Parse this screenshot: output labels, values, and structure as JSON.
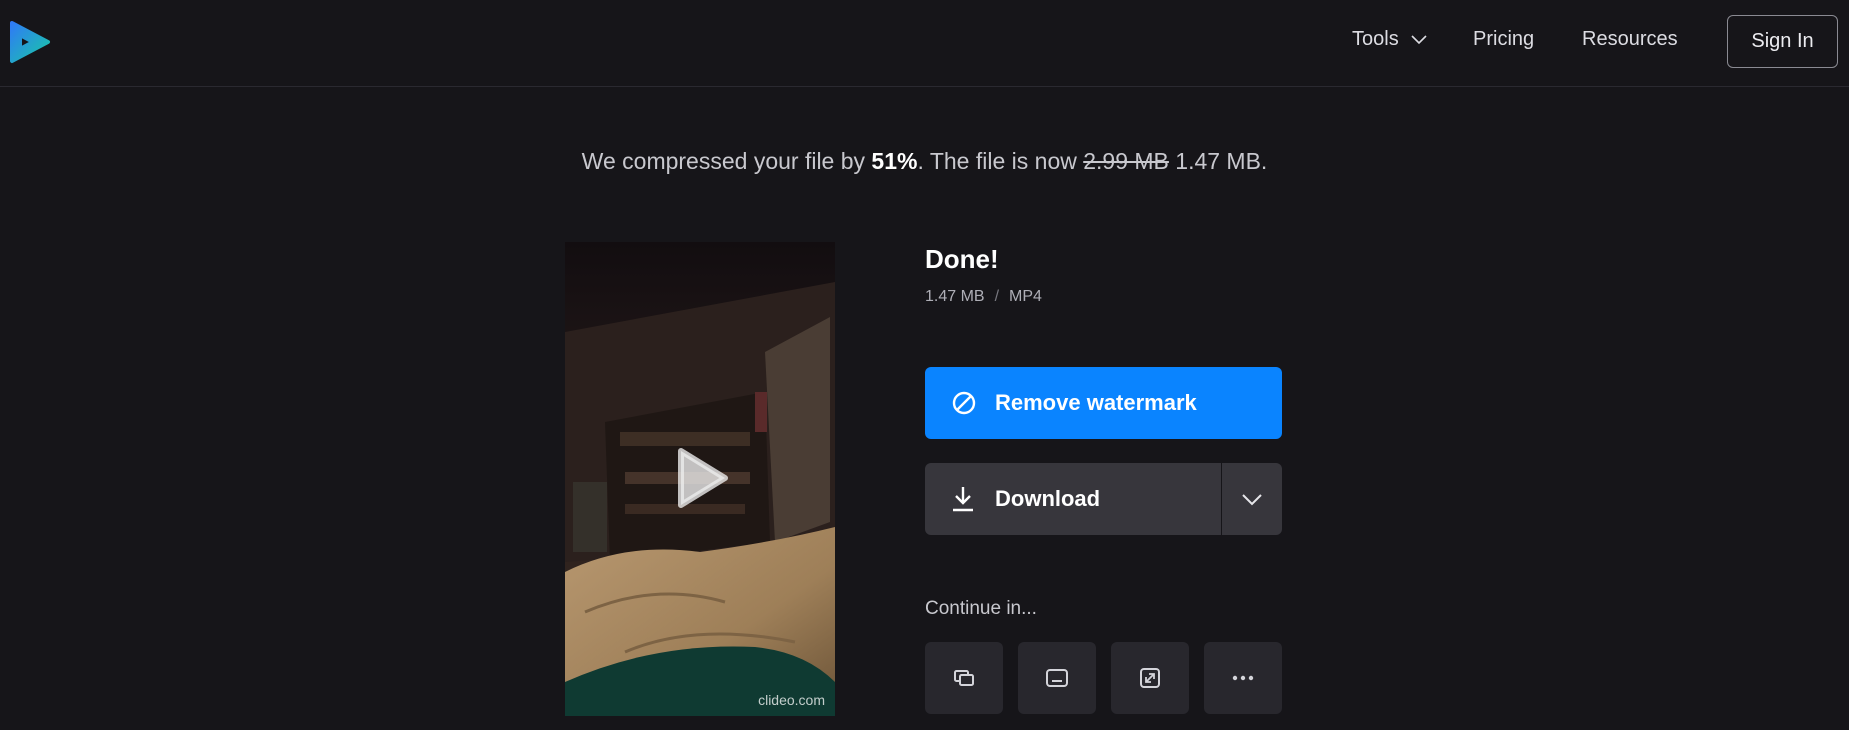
{
  "header": {
    "logo_icon": "play-logo-icon",
    "nav": {
      "tools": "Tools",
      "pricing": "Pricing",
      "resources": "Resources"
    },
    "sign_in": "Sign In"
  },
  "message": {
    "prefix": "We compressed your file by ",
    "percent": "51%",
    "middle": ". The file is now ",
    "old_size": "2.99 MB",
    "new_size": " 1.47 MB."
  },
  "video": {
    "watermark": "clideo.com",
    "play_icon": "play-icon"
  },
  "result": {
    "title": "Done!",
    "size": "1.47 MB",
    "separator": "/",
    "format": "MP4"
  },
  "actions": {
    "remove_watermark": "Remove watermark",
    "download": "Download"
  },
  "continue": {
    "label": "Continue in...",
    "tools": [
      "merge-icon",
      "subtitles-icon",
      "resize-icon",
      "more-icon"
    ]
  },
  "colors": {
    "background": "#161519",
    "accent": "#0a84ff",
    "button_dark": "#37363c"
  }
}
